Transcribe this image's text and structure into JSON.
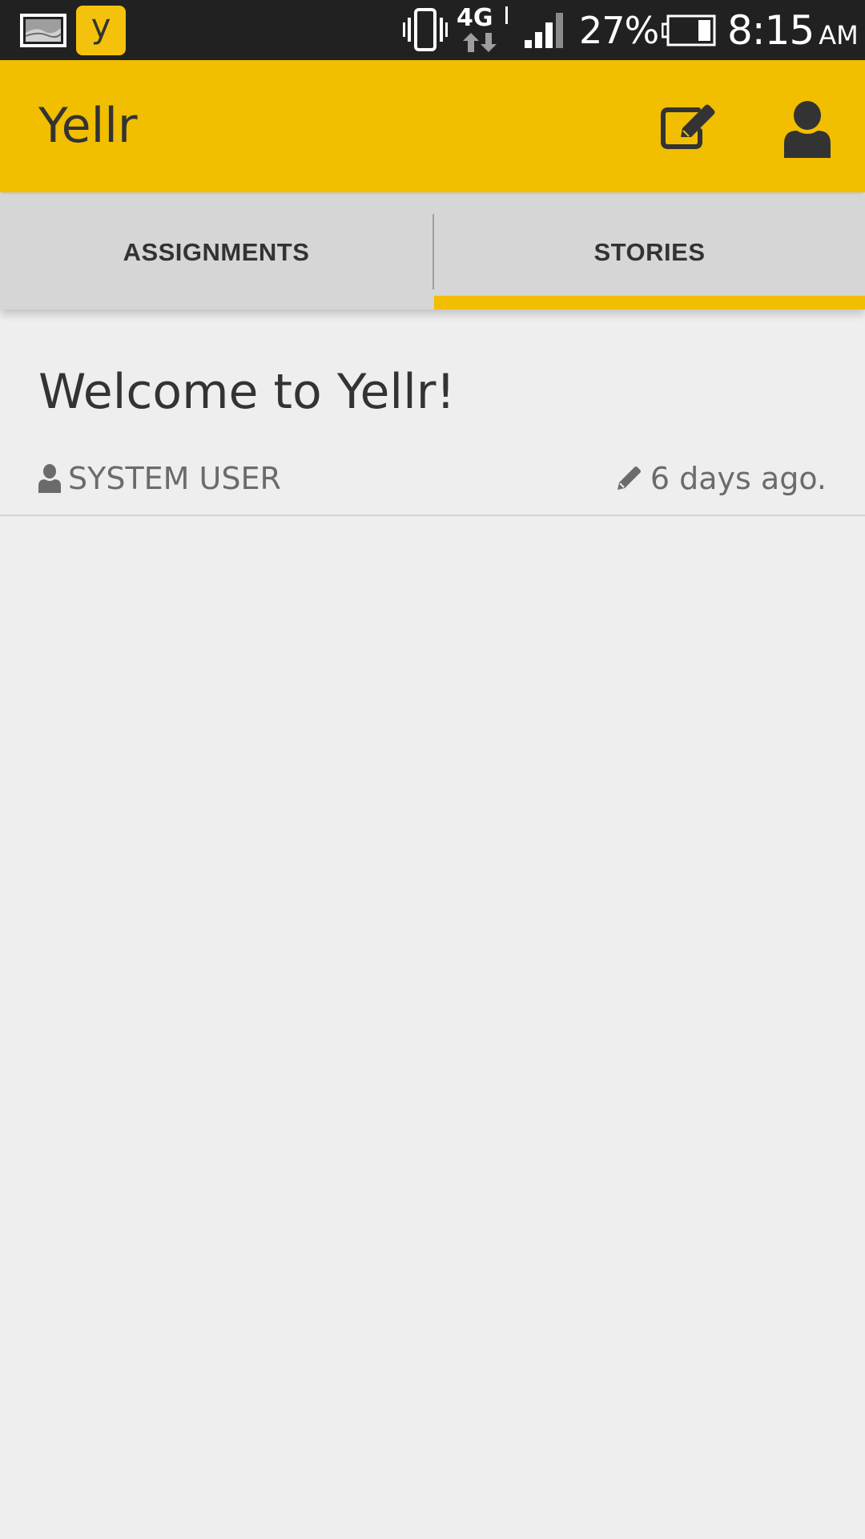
{
  "status_bar": {
    "notification_app_letter": "y",
    "battery_percent": "27%",
    "time": "8:15",
    "ampm": "AM",
    "network_label": "4G"
  },
  "app_bar": {
    "title": "Yellr"
  },
  "tabs": [
    {
      "label": "ASSIGNMENTS",
      "selected": false
    },
    {
      "label": "STORIES",
      "selected": true
    }
  ],
  "stories": [
    {
      "title": "Welcome to Yellr!",
      "author": "SYSTEM USER",
      "posted": "6 days ago."
    }
  ],
  "colors": {
    "accent": "#f1be00",
    "status_bar": "#212121",
    "tab_bar": "#d6d6d6",
    "background": "#eeeeee",
    "text_primary": "#333333",
    "text_secondary": "#6b6b6b"
  }
}
